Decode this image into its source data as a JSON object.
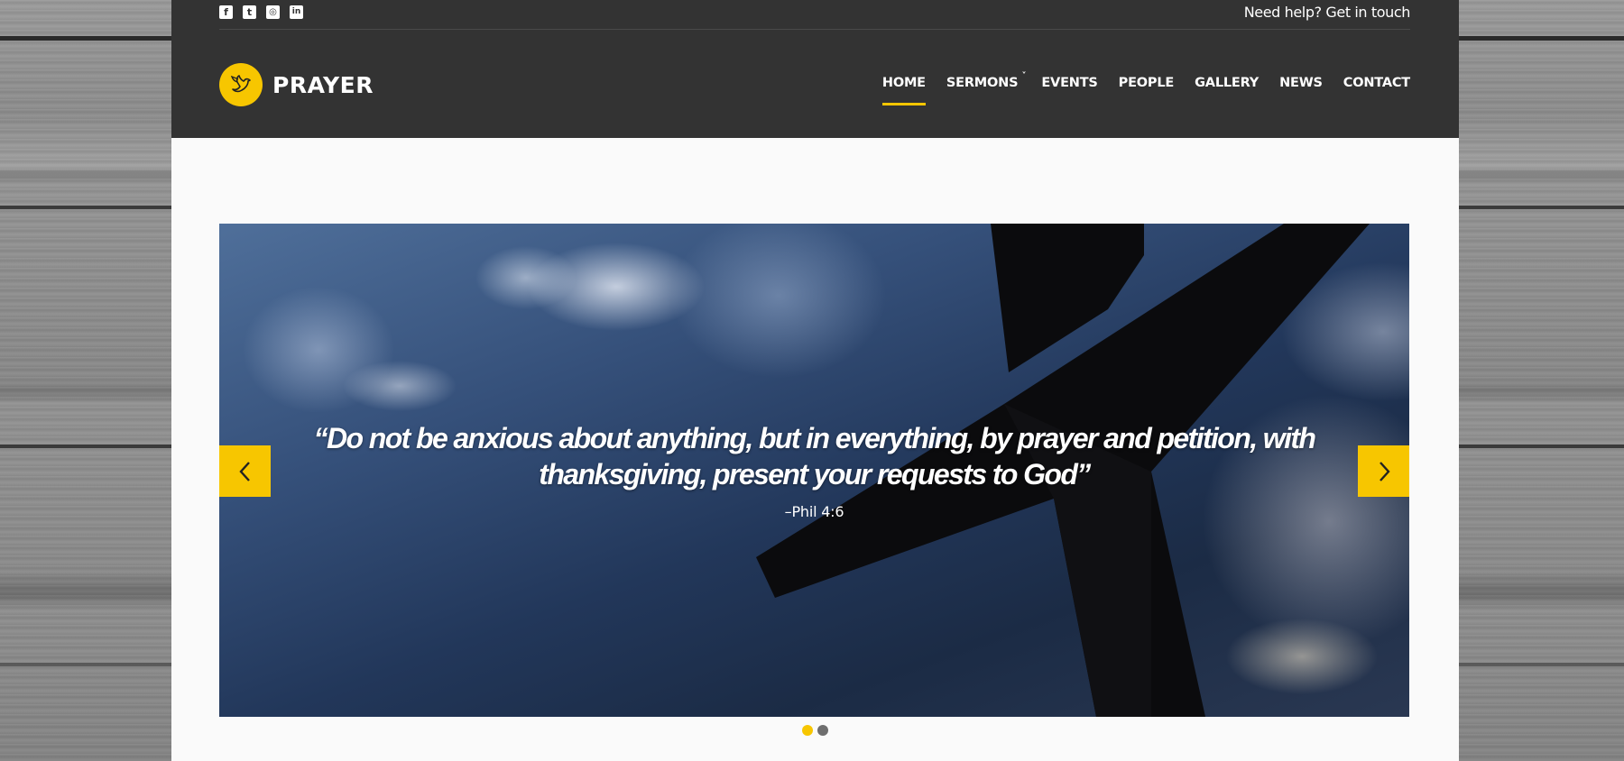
{
  "topbar": {
    "socials": [
      {
        "icon": "facebook-icon",
        "glyph": "f"
      },
      {
        "icon": "twitter-icon",
        "glyph": "t"
      },
      {
        "icon": "instagram-icon",
        "glyph": "◎"
      },
      {
        "icon": "linkedin-icon",
        "glyph": "in"
      }
    ],
    "help_text": "Need help? Get in touch"
  },
  "brand": {
    "logo_icon": "dove-icon",
    "name": "PRAYER",
    "accent_color": "#f7c600"
  },
  "nav": {
    "items": [
      {
        "label": "HOME",
        "active": true
      },
      {
        "label": "SERMONS",
        "has_submenu": true,
        "submenu_icon": "chevron-down-icon"
      },
      {
        "label": "EVENTS"
      },
      {
        "label": "PEOPLE"
      },
      {
        "label": "GALLERY"
      },
      {
        "label": "NEWS"
      },
      {
        "label": "CONTACT"
      }
    ]
  },
  "slider": {
    "quote": "“Do not be anxious about anything, but in everything, by prayer and petition, with thanksgiving, present your requests to God”",
    "attribution": "–Phil 4:6",
    "prev_icon": "chevron-left-icon",
    "next_icon": "chevron-right-icon",
    "slide_count": 2,
    "active_slide": 1
  }
}
